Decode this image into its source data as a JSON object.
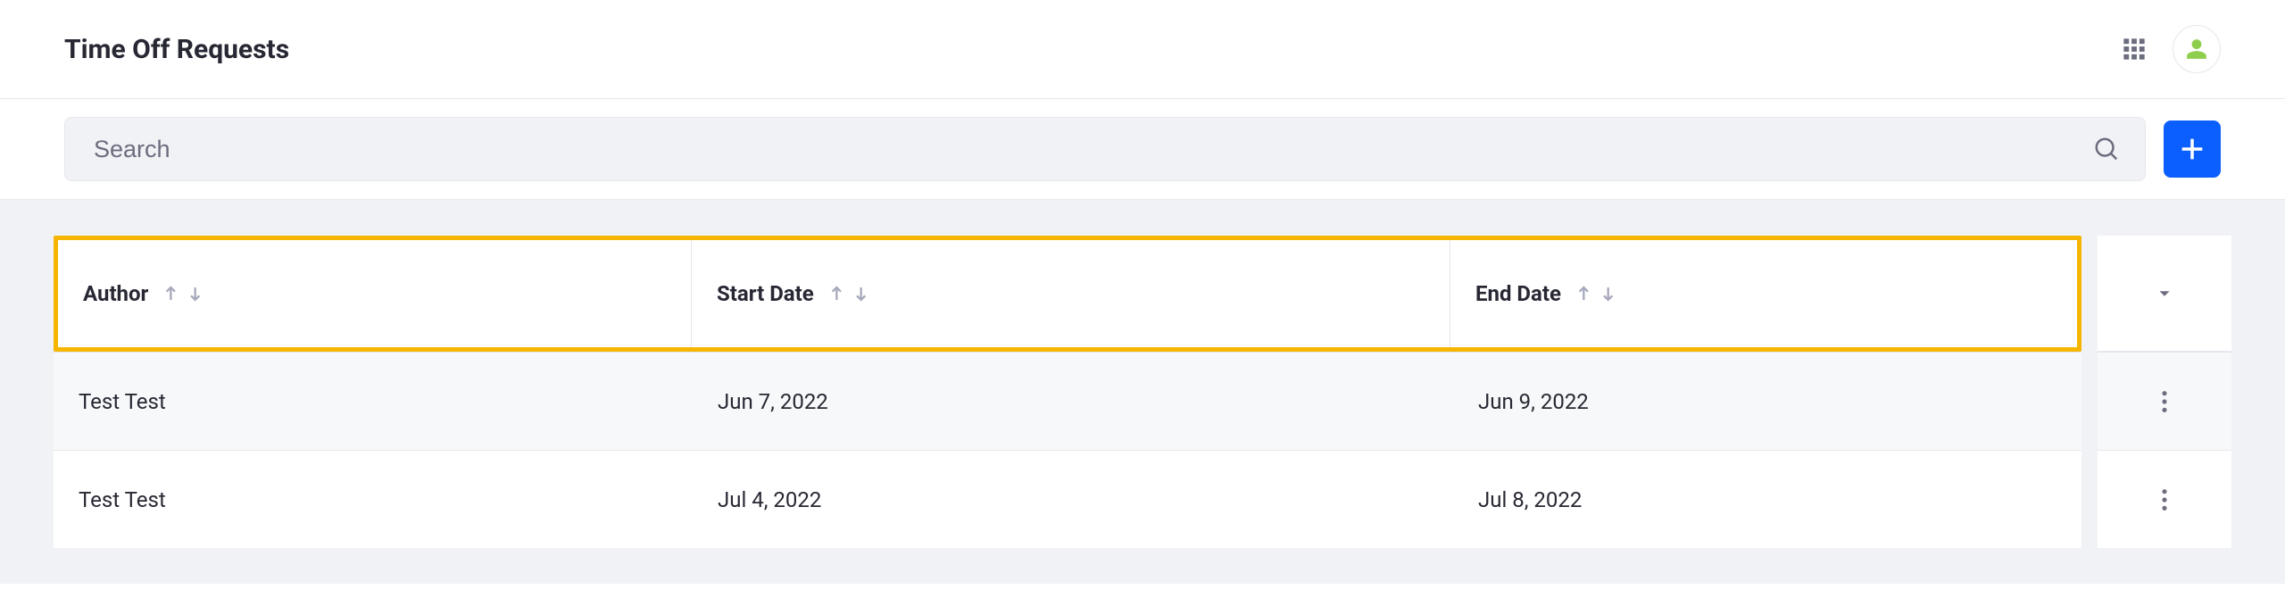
{
  "header": {
    "title": "Time Off Requests"
  },
  "search": {
    "placeholder": "Search",
    "value": ""
  },
  "table": {
    "columns": [
      {
        "label": "Author"
      },
      {
        "label": "Start Date"
      },
      {
        "label": "End Date"
      }
    ],
    "rows": [
      {
        "author": "Test Test",
        "start": "Jun 7, 2022",
        "end": "Jun 9, 2022"
      },
      {
        "author": "Test Test",
        "start": "Jul 4, 2022",
        "end": "Jul 8, 2022"
      }
    ]
  }
}
